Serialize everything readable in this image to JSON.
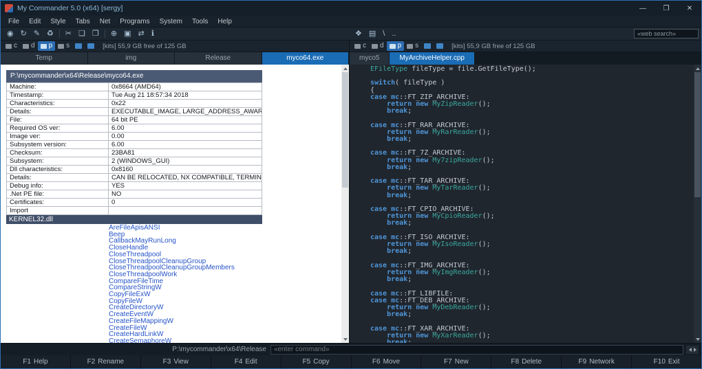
{
  "window": {
    "title": "My Commander 5.0 (x64) [sergy]",
    "controls": {
      "minimize": "—",
      "maximize": "❐",
      "close": "✕"
    }
  },
  "menubar": {
    "items": [
      "File",
      "Edit",
      "Style",
      "Tabs",
      "Net",
      "Programs",
      "System",
      "Tools",
      "Help"
    ]
  },
  "toolbar": {
    "left_icons": [
      {
        "name": "view-icon",
        "glyph": "◉"
      },
      {
        "name": "refresh-icon",
        "glyph": "↻"
      },
      {
        "name": "edit-icon",
        "glyph": "✎"
      },
      {
        "name": "delete-icon",
        "glyph": "♻"
      },
      {
        "name": "separator"
      },
      {
        "name": "cut-icon",
        "glyph": "✂"
      },
      {
        "name": "copy-icon",
        "glyph": "❏"
      },
      {
        "name": "paste-icon",
        "glyph": "❐"
      },
      {
        "name": "separator"
      },
      {
        "name": "network-icon",
        "glyph": "⊕"
      },
      {
        "name": "screen-icon",
        "glyph": "▣"
      },
      {
        "name": "compare-icon",
        "glyph": "⇄"
      },
      {
        "name": "info-icon",
        "glyph": "ℹ"
      }
    ],
    "right_icons": [
      {
        "name": "folder-new-icon",
        "glyph": "❖"
      },
      {
        "name": "folder-icon",
        "glyph": "▤"
      },
      {
        "name": "root-folder-icon",
        "glyph": "\\"
      },
      {
        "name": "parent-folder-icon",
        "glyph": ".."
      }
    ],
    "web_search_placeholder": "«web search»"
  },
  "left_pane": {
    "drivebar": {
      "drives": [
        {
          "label": "c"
        },
        {
          "label": "d"
        },
        {
          "label": "p",
          "active": true
        },
        {
          "label": "s"
        }
      ],
      "shortcuts": [
        {
          "name": "folder-shortcut-icon"
        },
        {
          "name": "network-shortcut-icon"
        }
      ],
      "free_space": "[kits] 55,9 GB free of 125 GB"
    },
    "tabs": [
      {
        "label": "Temp"
      },
      {
        "label": "img"
      },
      {
        "label": "Release"
      },
      {
        "label": "myco64.exe",
        "active": true
      }
    ],
    "viewer": {
      "title": "P:\\mycommander\\x64\\Release\\myco64.exe",
      "rows": [
        {
          "label": "Machine:",
          "value": "0x8664 (AMD64)"
        },
        {
          "label": "Timestamp:",
          "value": "Tue Aug 21 18:57:34 2018"
        },
        {
          "label": "Characteristics:",
          "value": "0x22"
        },
        {
          "label": "Details:",
          "value": "EXECUTABLE_IMAGE, LARGE_ADDRESS_AWARE,"
        },
        {
          "label": "File:",
          "value": "64 bit PE"
        },
        {
          "label": "Required OS ver:",
          "value": "6.00"
        },
        {
          "label": "Image ver:",
          "value": "0.00"
        },
        {
          "label": "Subsystem version:",
          "value": "6.00"
        },
        {
          "label": "Checksum:",
          "value": "23BA81"
        },
        {
          "label": "Subsystem:",
          "value": "2 (WINDOWS_GUI)"
        },
        {
          "label": "Dll characteristics:",
          "value": "0x8160"
        },
        {
          "label": "Details:",
          "value": "CAN BE RELOCATED, NX COMPATIBLE, TERMINAL SERVER AWARE,"
        },
        {
          "label": "Debug info:",
          "value": "YES"
        },
        {
          "label": ".Net PE file:",
          "value": "NO"
        },
        {
          "label": "Certificates:",
          "value": "0"
        },
        {
          "label": "Import",
          "value": ""
        }
      ],
      "selected_dll": "KERNEL32.dll",
      "functions": [
        "AreFileApisANSI",
        "Beep",
        "CallbackMayRunLong",
        "CloseHandle",
        "CloseThreadpool",
        "CloseThreadpoolCleanupGroup",
        "CloseThreadpoolCleanupGroupMembers",
        "CloseThreadpoolWork",
        "CompareFileTime",
        "CompareStringW",
        "CopyFileExW",
        "CopyFileW",
        "CreateDirectoryW",
        "CreateEventW",
        "CreateFileMappingW",
        "CreateFileW",
        "CreateHardLinkW",
        "CreateSemaphoreW"
      ]
    }
  },
  "right_pane": {
    "drivebar": {
      "drives": [
        {
          "label": "c"
        },
        {
          "label": "d"
        },
        {
          "label": "p",
          "active": true
        },
        {
          "label": "s"
        }
      ],
      "shortcuts": [
        {
          "name": "folder-shortcut-icon"
        },
        {
          "name": "network-shortcut-icon"
        }
      ],
      "free_space": "[kits] 55,9 GB free of 125 GB"
    },
    "tabs": [
      {
        "label": "myco5"
      },
      {
        "label": "MyArchiveHelper.cpp",
        "active": true
      }
    ],
    "code_lines": [
      "EFileType fileType = file.GetFileType();",
      "",
      "switch( fileType )",
      "{",
      "case mc::FT_ZIP_ARCHIVE:",
      "    return new MyZipReader();",
      "    break;",
      "",
      "case mc::FT_RAR_ARCHIVE:",
      "    return new MyRarReader();",
      "    break;",
      "",
      "case mc::FT_7Z_ARCHIVE:",
      "    return new My7zipReader();",
      "    break;",
      "",
      "case mc::FT_TAR_ARCHIVE:",
      "    return new MyTarReader();",
      "    break;",
      "",
      "case mc::FT_CPIO_ARCHIVE:",
      "    return new MyCpioReader();",
      "    break;",
      "",
      "case mc::FT_ISO_ARCHIVE:",
      "    return new MyIsoReader();",
      "    break;",
      "",
      "case mc::FT_IMG_ARCHIVE:",
      "    return new MyImgReader();",
      "    break;",
      "",
      "case mc::FT_LIBFILE:",
      "case mc::FT_DEB_ARCHIVE:",
      "    return new MyDebReader();",
      "    break;",
      "",
      "case mc::FT_XAR_ARCHIVE:",
      "    return new MyXarReader();",
      "    break;"
    ]
  },
  "bottombar": {
    "path": "P:\\mycommander\\x64\\Release",
    "command_placeholder": "«enter command»"
  },
  "function_keys": [
    {
      "key": "F1",
      "label": "Help"
    },
    {
      "key": "F2",
      "label": "Rename"
    },
    {
      "key": "F3",
      "label": "View"
    },
    {
      "key": "F4",
      "label": "Edit"
    },
    {
      "key": "F5",
      "label": "Copy"
    },
    {
      "key": "F6",
      "label": "Move"
    },
    {
      "key": "F7",
      "label": "New"
    },
    {
      "key": "F8",
      "label": "Delete"
    },
    {
      "key": "F9",
      "label": "Network"
    },
    {
      "key": "F10",
      "label": "Exit"
    }
  ]
}
